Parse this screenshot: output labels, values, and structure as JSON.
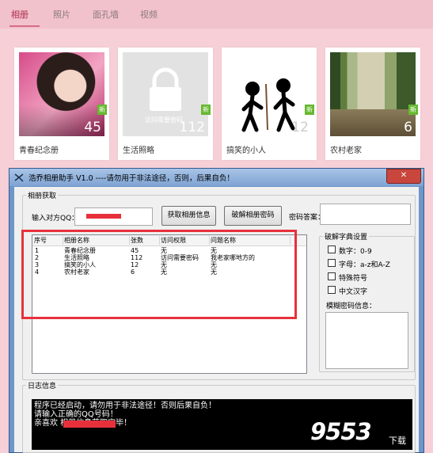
{
  "nav": {
    "tabs": [
      "相册",
      "照片",
      "面孔墙",
      "视频"
    ]
  },
  "albums": [
    {
      "name": "青春纪念册",
      "count": "45",
      "badge": "新"
    },
    {
      "name": "生活照略",
      "count": "112",
      "badge": "新",
      "lock_text": "访问需要密码"
    },
    {
      "name": "搞笑的小人",
      "count": "12",
      "badge": "新"
    },
    {
      "name": "农村老家",
      "count": "6",
      "badge": "新"
    }
  ],
  "window": {
    "title": "浩乔相册助手 V1.0    ----请勿用于非法途径，否则，后果自负！",
    "close": "✕",
    "group_fetch": "相册获取",
    "qq_label": "输入对方QQ：",
    "btn_get": "获取相册信息",
    "btn_crack": "破解相册密码",
    "answer_label": "密码答案：",
    "table_headers": [
      "序号",
      "相册名称",
      "张数",
      "访问权限",
      "问题名称"
    ],
    "rows": [
      [
        "1",
        "青春纪念册",
        "45",
        "无",
        "无"
      ],
      [
        "2",
        "生活照略",
        "112",
        "访问需要密码",
        "我老家哪地方的"
      ],
      [
        "3",
        "搞笑的小人",
        "12",
        "无",
        "无"
      ],
      [
        "4",
        "农村老家",
        "6",
        "无",
        "无"
      ]
    ],
    "dict_group": "破解字典设置",
    "dict_options": [
      "数字：0-9",
      "字母：a-z和A-Z",
      "特殊符号",
      "中文汉字"
    ],
    "fuzzy_label": "模糊密码信息：",
    "log_group": "日志信息",
    "log_lines": [
      "程序已经启动，请勿用于非法途径！否则后果自负！",
      "请输入正确的QQ号码！",
      "亲喜欢             相册信息获取完毕！"
    ]
  },
  "watermark": {
    "text": "9553",
    "sub": "下载"
  },
  "colors": {
    "accent": "#e8303c",
    "badge": "#66b82e",
    "nav_active": "#c25a73"
  }
}
